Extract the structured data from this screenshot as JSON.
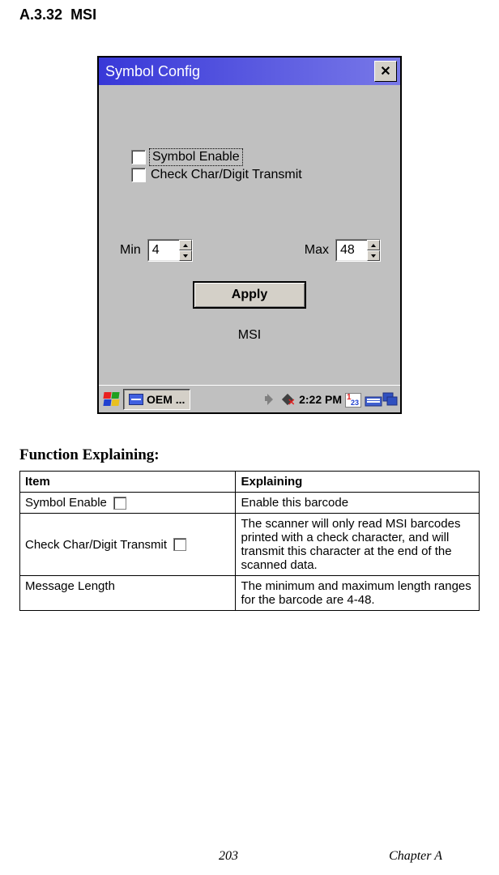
{
  "section": {
    "number": "A.3.32",
    "title": "MSI"
  },
  "dialog": {
    "title": "Symbol Config",
    "checkboxes": {
      "symbol_enable": "Symbol Enable",
      "check_char": "Check Char/Digit Transmit"
    },
    "min_label": "Min",
    "min_value": "4",
    "max_label": "Max",
    "max_value": "48",
    "apply": "Apply",
    "footer_label": "MSI"
  },
  "taskbar": {
    "app": "OEM ...",
    "time": "2:22 PM",
    "cal_day": "1",
    "cal_sub": "23"
  },
  "table": {
    "heading": "Function Explaining:",
    "headers": {
      "item": "Item",
      "explaining": "Explaining"
    },
    "rows": [
      {
        "item": "Symbol Enable",
        "has_checkbox": true,
        "explaining": "Enable this barcode"
      },
      {
        "item": "Check Char/Digit Transmit",
        "has_checkbox": true,
        "explaining": "The scanner will only read MSI barcodes printed with a check character, and will transmit this character at the end of the scanned data."
      },
      {
        "item": "Message Length",
        "has_checkbox": false,
        "explaining": "The minimum and maximum length ranges for the barcode are 4-48."
      }
    ]
  },
  "footer": {
    "page": "203",
    "chapter": "Chapter A"
  }
}
